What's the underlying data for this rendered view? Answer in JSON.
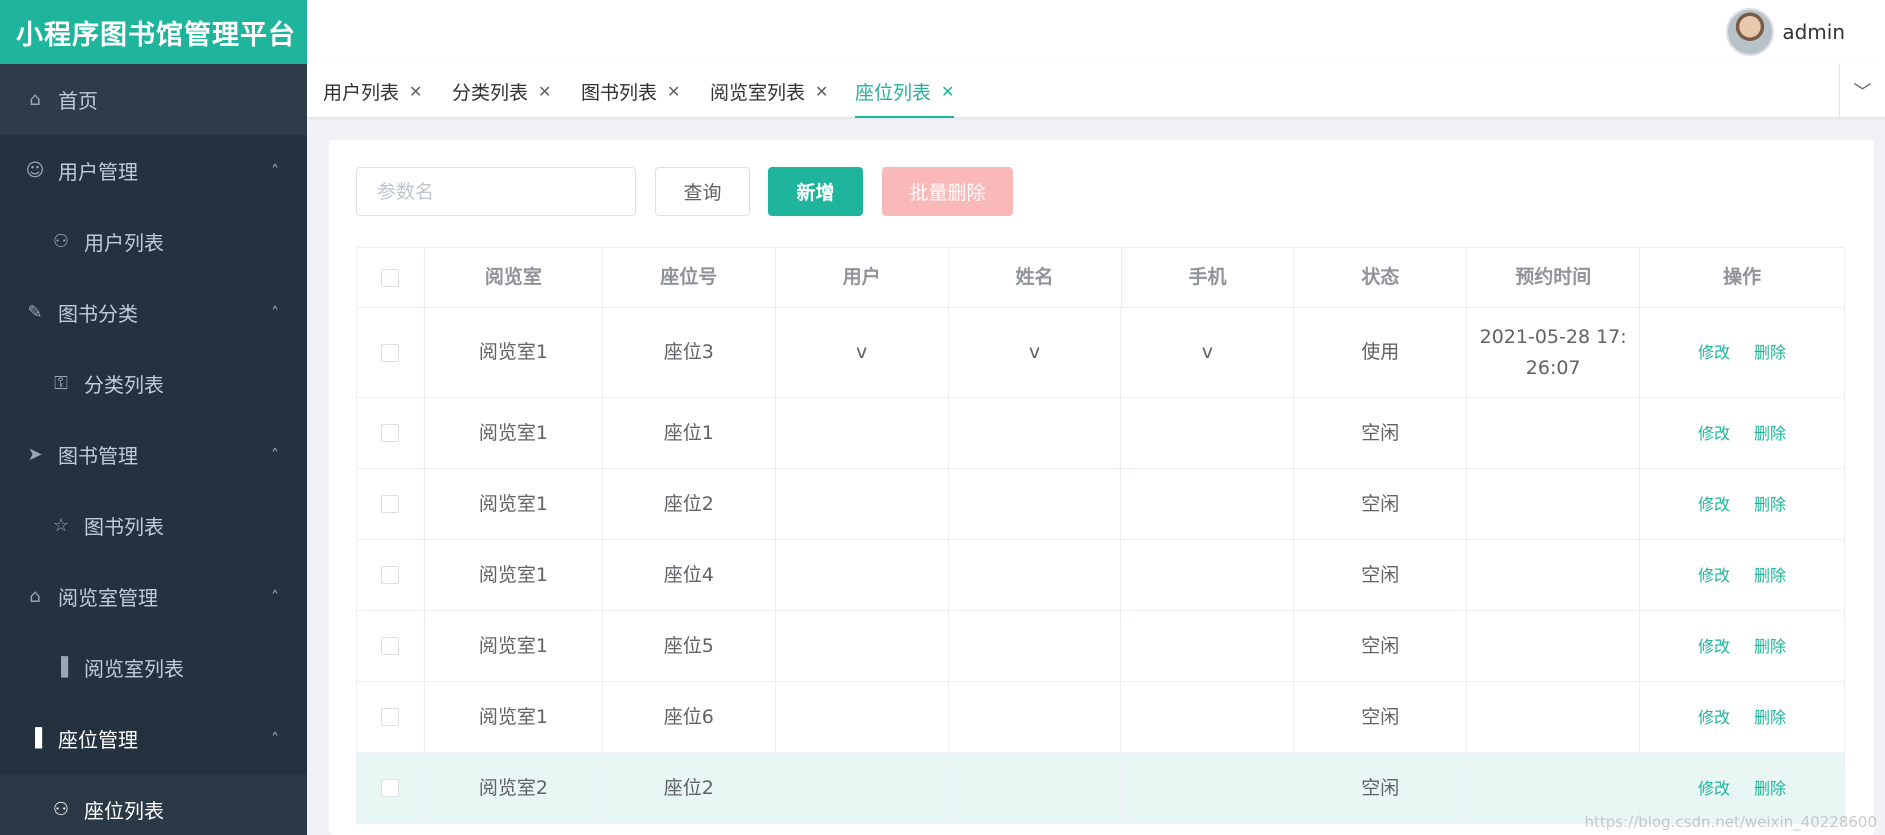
{
  "app": {
    "title": "小程序图书馆管理平台"
  },
  "header": {
    "user_name": "admin"
  },
  "sidebar": {
    "items": [
      {
        "label": "首页",
        "icon": "home-icon",
        "level": "top"
      },
      {
        "label": "用户管理",
        "icon": "user-icon",
        "level": "group"
      },
      {
        "label": "用户列表",
        "icon": "agent-icon",
        "level": "sub"
      },
      {
        "label": "图书分类",
        "icon": "edit-icon",
        "level": "group"
      },
      {
        "label": "分类列表",
        "icon": "lock-icon",
        "level": "sub"
      },
      {
        "label": "图书管理",
        "icon": "send-icon",
        "level": "group"
      },
      {
        "label": "图书列表",
        "icon": "star-icon",
        "level": "sub"
      },
      {
        "label": "阅览室管理",
        "icon": "home-icon",
        "level": "group"
      },
      {
        "label": "阅览室列表",
        "icon": "chart-icon",
        "level": "sub"
      },
      {
        "label": "座位管理",
        "icon": "chart-icon",
        "level": "group-active"
      },
      {
        "label": "座位列表",
        "icon": "agent-icon",
        "level": "sub-active"
      }
    ]
  },
  "tabs": [
    {
      "label": "用户列表",
      "active": false
    },
    {
      "label": "分类列表",
      "active": false
    },
    {
      "label": "图书列表",
      "active": false
    },
    {
      "label": "阅览室列表",
      "active": false
    },
    {
      "label": "座位列表",
      "active": true
    }
  ],
  "toolbar": {
    "search_placeholder": "参数名",
    "query_label": "查询",
    "add_label": "新增",
    "batch_delete_label": "批量删除"
  },
  "table": {
    "headers": [
      "阅览室",
      "座位号",
      "用户",
      "姓名",
      "手机",
      "状态",
      "预约时间",
      "操作"
    ],
    "edit_label": "修改",
    "delete_label": "删除",
    "rows": [
      {
        "room": "阅览室1",
        "seat": "座位3",
        "user": "v",
        "name": "v",
        "phone": "v",
        "status": "使用",
        "time": "2021-05-28 17:26:07",
        "highlight": false
      },
      {
        "room": "阅览室1",
        "seat": "座位1",
        "user": "",
        "name": "",
        "phone": "",
        "status": "空闲",
        "time": "",
        "highlight": false
      },
      {
        "room": "阅览室1",
        "seat": "座位2",
        "user": "",
        "name": "",
        "phone": "",
        "status": "空闲",
        "time": "",
        "highlight": false
      },
      {
        "room": "阅览室1",
        "seat": "座位4",
        "user": "",
        "name": "",
        "phone": "",
        "status": "空闲",
        "time": "",
        "highlight": false
      },
      {
        "room": "阅览室1",
        "seat": "座位5",
        "user": "",
        "name": "",
        "phone": "",
        "status": "空闲",
        "time": "",
        "highlight": false
      },
      {
        "room": "阅览室1",
        "seat": "座位6",
        "user": "",
        "name": "",
        "phone": "",
        "status": "空闲",
        "time": "",
        "highlight": false
      },
      {
        "room": "阅览室2",
        "seat": "座位2",
        "user": "",
        "name": "",
        "phone": "",
        "status": "空闲",
        "time": "",
        "highlight": true
      }
    ]
  },
  "watermark": "https://blog.csdn.net/weixin_40228600",
  "colors": {
    "accent": "#1fb59c",
    "sidebar": "#304156",
    "danger_light": "#f9b9b9"
  }
}
